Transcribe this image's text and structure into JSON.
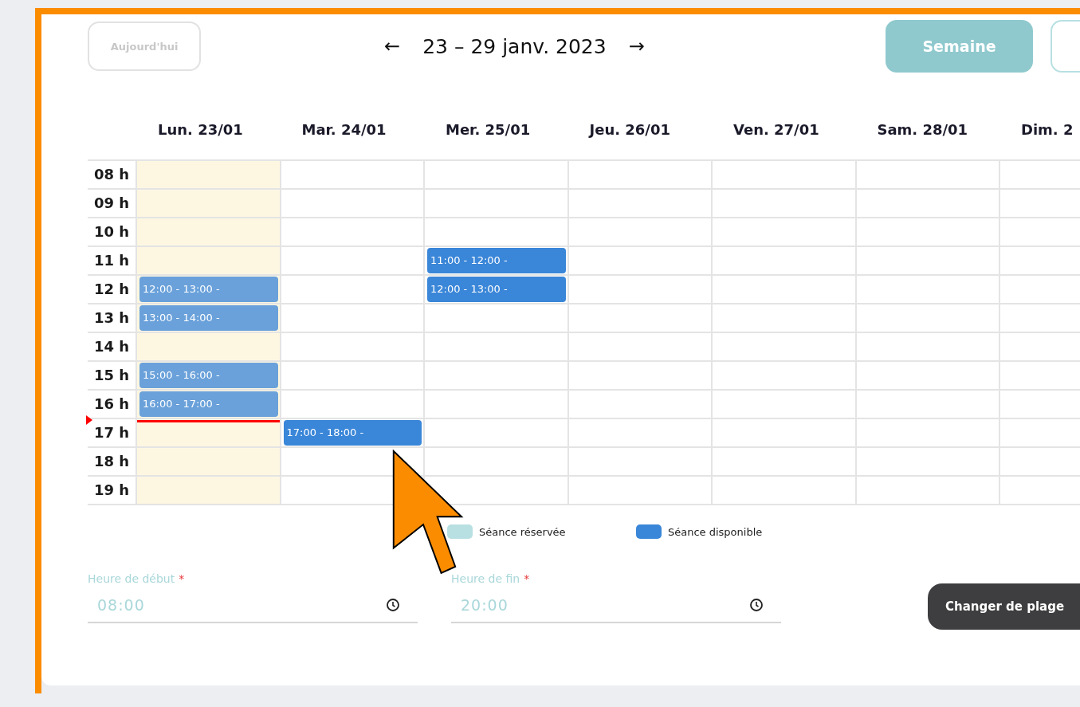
{
  "toolbar": {
    "today_button": {
      "label": "Aujourd'hui",
      "disabled": true
    },
    "prev": "←",
    "title": "23 – 29 janv. 2023",
    "next": "→",
    "views": [
      {
        "label": "Semaine",
        "selected": true
      },
      {
        "selected": false
      }
    ]
  },
  "days": [
    {
      "label": "Lun. 23/01",
      "today": true
    },
    {
      "label": "Mar. 24/01",
      "today": false
    },
    {
      "label": "Mer. 25/01",
      "today": false
    },
    {
      "label": "Jeu. 26/01",
      "today": false
    },
    {
      "label": "Ven. 27/01",
      "today": false
    },
    {
      "label": "Sam. 28/01",
      "today": false
    },
    {
      "label": "Dim. 2",
      "today": false
    }
  ],
  "rows": [
    {
      "label": "08 h",
      "now": false,
      "cells": [
        null,
        null,
        null,
        null,
        null,
        null,
        null
      ]
    },
    {
      "label": "09 h",
      "now": false,
      "cells": [
        null,
        null,
        null,
        null,
        null,
        null,
        null
      ]
    },
    {
      "label": "10 h",
      "now": false,
      "cells": [
        null,
        null,
        null,
        null,
        null,
        null,
        null
      ]
    },
    {
      "label": "11 h",
      "now": false,
      "cells": [
        null,
        null,
        {
          "text": "11:00 - 12:00 -",
          "kind": "available"
        },
        null,
        null,
        null,
        null
      ]
    },
    {
      "label": "12 h",
      "now": false,
      "cells": [
        {
          "text": "12:00 - 13:00 -",
          "kind": "past"
        },
        null,
        {
          "text": "12:00 - 13:00 -",
          "kind": "available"
        },
        null,
        null,
        null,
        null
      ]
    },
    {
      "label": "13 h",
      "now": false,
      "cells": [
        {
          "text": "13:00 - 14:00 -",
          "kind": "past"
        },
        null,
        null,
        null,
        null,
        null,
        null
      ]
    },
    {
      "label": "14 h",
      "now": false,
      "cells": [
        null,
        null,
        null,
        null,
        null,
        null,
        null
      ]
    },
    {
      "label": "15 h",
      "now": false,
      "cells": [
        {
          "text": "15:00 - 16:00 -",
          "kind": "past"
        },
        null,
        null,
        null,
        null,
        null,
        null
      ]
    },
    {
      "label": "16 h",
      "now": false,
      "cells": [
        {
          "text": "16:00 - 17:00 -",
          "kind": "past"
        },
        null,
        null,
        null,
        null,
        null,
        null
      ]
    },
    {
      "label": "17 h",
      "now": true,
      "cells": [
        null,
        {
          "text": "17:00 - 18:00 -",
          "kind": "available"
        },
        null,
        null,
        null,
        null,
        null
      ]
    },
    {
      "label": "18 h",
      "now": false,
      "cells": [
        null,
        null,
        null,
        null,
        null,
        null,
        null
      ]
    },
    {
      "label": "19 h",
      "now": false,
      "cells": [
        null,
        null,
        null,
        null,
        null,
        null,
        null
      ]
    }
  ],
  "legend": [
    {
      "label": "Séance réservée",
      "color": "#b8e0e2"
    },
    {
      "label": "Séance disponible",
      "color": "#3a86d8"
    }
  ],
  "fields": [
    {
      "label": "Heure de début",
      "required_mark": "*",
      "value": "08:00"
    },
    {
      "label": "Heure de fin",
      "required_mark": "*",
      "value": "20:00"
    }
  ],
  "action_button": {
    "label": "Changer de plage"
  }
}
